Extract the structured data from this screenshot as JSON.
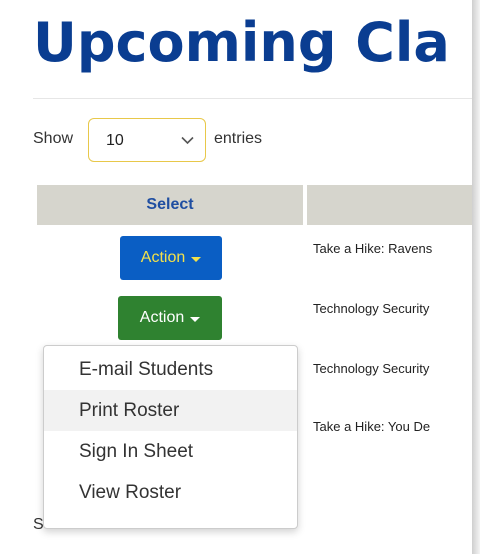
{
  "page": {
    "title": "Upcoming Cla"
  },
  "length_control": {
    "show_label": "Show",
    "selected_value": "10",
    "entries_label": "entries"
  },
  "table": {
    "columns": [
      "Select",
      ""
    ],
    "rows": [
      {
        "action_label": "Action",
        "title": "Take a Hike: Ravens"
      },
      {
        "action_label": "Action",
        "title": "Technology Security"
      },
      {
        "title": "Technology Security"
      },
      {
        "title": "Take a Hike: You De"
      }
    ]
  },
  "partial_label": "S",
  "action_menu": {
    "items": [
      {
        "label": "E-mail Students"
      },
      {
        "label": "Print Roster",
        "highlighted": true
      },
      {
        "label": "Sign In Sheet"
      },
      {
        "label": "View Roster"
      }
    ]
  },
  "colors": {
    "title": "#0a3d91",
    "header_bg": "#d6d5cd",
    "header_text": "#1f4ea1",
    "action_blue": "#0a5ec4",
    "action_blue_text": "#f3e14a",
    "action_green": "#2f8230",
    "select_border": "#e8c84a"
  }
}
